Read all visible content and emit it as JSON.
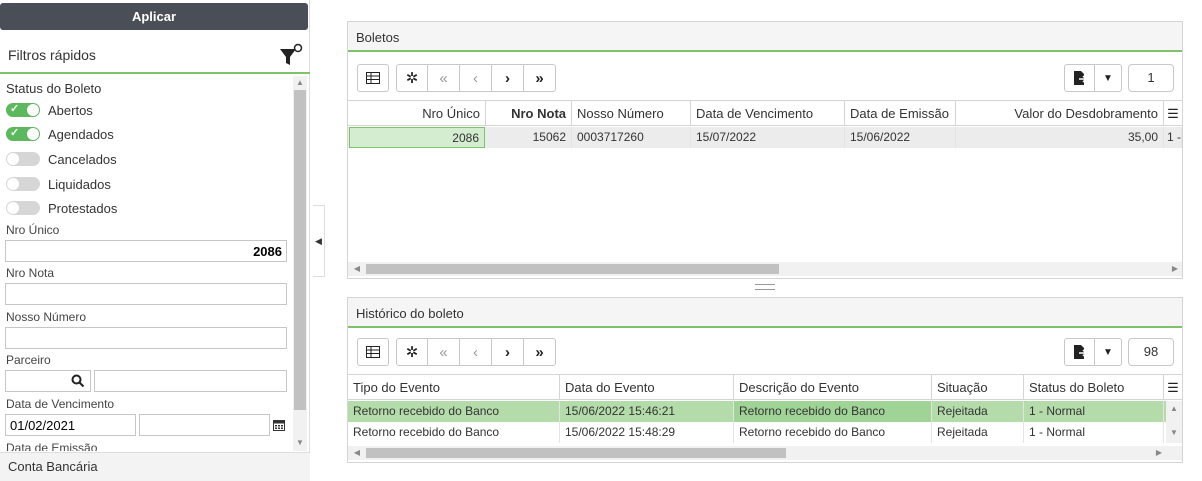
{
  "sidebar": {
    "apply_label": "Aplicar",
    "quick_filters_title": "Filtros rápidos",
    "status_section_title": "Status do Boleto",
    "status_toggles": [
      {
        "label": "Abertos",
        "on": true
      },
      {
        "label": "Agendados",
        "on": true
      },
      {
        "label": "Cancelados",
        "on": false
      },
      {
        "label": "Liquidados",
        "on": false
      },
      {
        "label": "Protestados",
        "on": false
      }
    ],
    "nro_unico": {
      "label": "Nro Único",
      "value": "2086"
    },
    "nro_nota": {
      "label": "Nro Nota",
      "value": ""
    },
    "nosso_numero": {
      "label": "Nosso Número",
      "value": ""
    },
    "parceiro": {
      "label": "Parceiro",
      "code": "",
      "name": ""
    },
    "data_vencimento": {
      "label": "Data de Vencimento",
      "from": "01/02/2021",
      "to": ""
    },
    "data_emissao": {
      "label": "Data de Emissão"
    },
    "conta_bancaria_label": "Conta Bancária"
  },
  "boletos": {
    "title": "Boletos",
    "page": "1",
    "columns": [
      "Nro Único",
      "Nro Nota",
      "Nosso Número",
      "Data de Vencimento",
      "Data de Emissão",
      "Valor do Desdobramento"
    ],
    "rows": [
      {
        "nro_unico": "2086",
        "nro_nota": "15062",
        "nosso_numero": "0003717260",
        "vencimento": "15/07/2022",
        "emissao": "15/06/2022",
        "valor": "35,00",
        "extra": "1 -"
      }
    ]
  },
  "historico": {
    "title": "Histórico do boleto",
    "page": "98",
    "columns": [
      "Tipo do Evento",
      "Data do Evento",
      "Descrição do Evento",
      "Situação",
      "Status do Boleto"
    ],
    "rows": [
      {
        "tipo": "Retorno recebido do Banco",
        "data": "15/06/2022 15:46:21",
        "descricao": "Retorno recebido do Banco",
        "situacao": "Rejeitada",
        "status": "1 - Normal"
      },
      {
        "tipo": "Retorno recebido do Banco",
        "data": "15/06/2022 15:48:29",
        "descricao": "Retorno recebido do Banco",
        "situacao": "Rejeitada",
        "status": "1 - Normal"
      }
    ]
  },
  "colors": {
    "accent_green": "#7cc36a",
    "toggle_on": "#5cb85c",
    "selected_row": "#a9d8a0",
    "apply_bg": "#4a4f57"
  },
  "icons": [
    "filter-clear-icon",
    "grid-icon",
    "gear-icon",
    "first-page-icon",
    "prev-page-icon",
    "next-page-icon",
    "last-page-icon",
    "export-icon",
    "caret-down-icon",
    "search-icon",
    "calendar-icon",
    "column-menu-icon",
    "collapse-left-icon"
  ]
}
